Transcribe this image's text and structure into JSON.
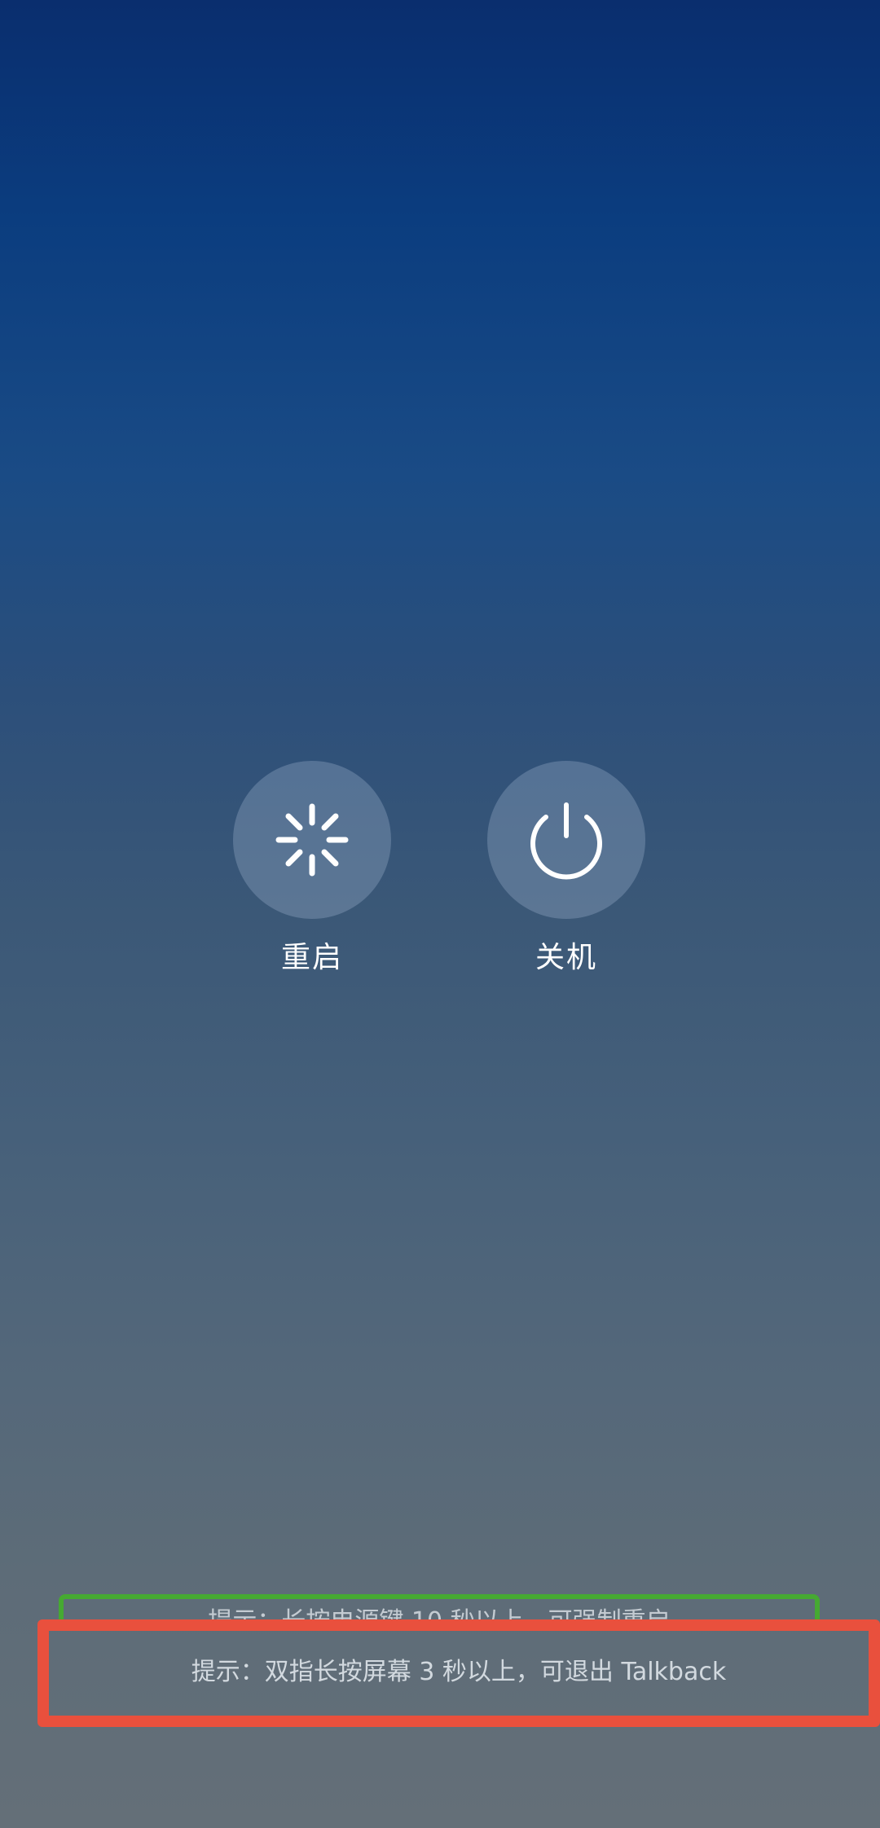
{
  "power_menu": {
    "restart": {
      "label": "重启",
      "icon": "restart-spinner-icon"
    },
    "power_off": {
      "label": "关机",
      "icon": "power-icon"
    }
  },
  "hints": {
    "force_restart": "提示：长按电源键 10 秒以上，可强制重启",
    "exit_talkback": "提示：双指长按屏幕 3 秒以上，可退出 Talkback"
  },
  "colors": {
    "highlight_green": "#46a932",
    "highlight_red": "#e9503d",
    "label_text": "#ffffff"
  }
}
